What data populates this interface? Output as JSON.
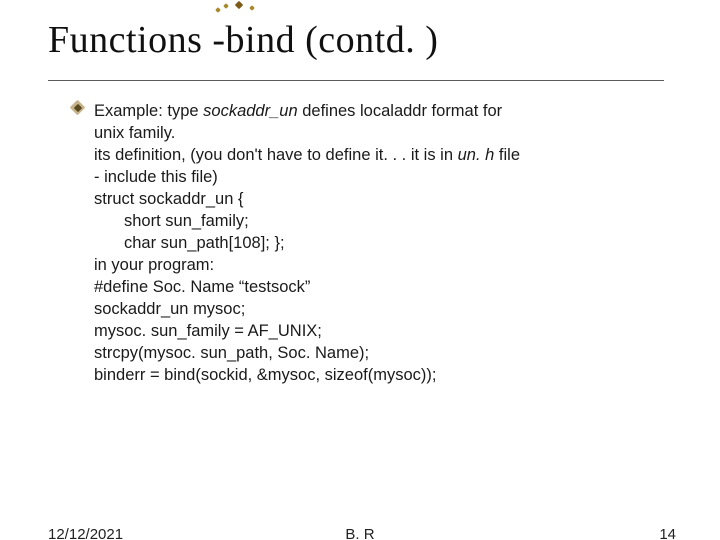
{
  "title": "Functions -bind (contd. )",
  "body": {
    "l0": {
      "a": "Example: type ",
      "b": "sockaddr_un",
      "c": " defines localaddr format for"
    },
    "l1": "unix family.",
    "l2": {
      "a": "its definition, (you don't have to define it. . . it is in ",
      "b": "un. h",
      "c": " file"
    },
    "l3": "- include this file)",
    "l4": "struct sockaddr_un {",
    "l5": "short sun_family;",
    "l6": "char sun_path[108]; };",
    "l7": "in your program:",
    "l8": "#define Soc. Name “testsock”",
    "l9": "sockaddr_un  mysoc;",
    "l10": "mysoc. sun_family = AF_UNIX;",
    "l11": "strcpy(mysoc. sun_path, Soc. Name);",
    "l12": "binderr = bind(sockid, &mysoc, sizeof(mysoc));"
  },
  "footer": {
    "date": "12/12/2021",
    "author": "B. R",
    "page": "14"
  }
}
